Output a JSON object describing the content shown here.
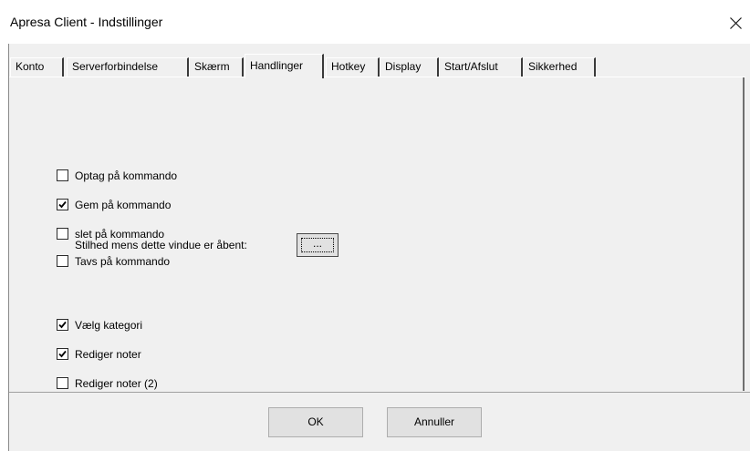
{
  "window": {
    "title": "Apresa Client - Indstillinger",
    "close_icon": "close-icon"
  },
  "tabs": [
    {
      "label": "Konto",
      "active": false
    },
    {
      "label": "Serverforbindelse",
      "active": false
    },
    {
      "label": "Skærm",
      "active": false
    },
    {
      "label": "Handlinger",
      "active": true
    },
    {
      "label": "Hotkey",
      "active": false
    },
    {
      "label": "Display",
      "active": false
    },
    {
      "label": "Start/Afslut",
      "active": false
    },
    {
      "label": "Sikkerhed",
      "active": false
    }
  ],
  "options": [
    {
      "label": "Optag på kommando",
      "checked": false
    },
    {
      "label": "Gem på kommando",
      "checked": true
    },
    {
      "label": "slet på kommando",
      "checked": false
    },
    {
      "label": "Tavs på kommando",
      "checked": false
    },
    {
      "label": "Vælg kategori",
      "checked": true
    },
    {
      "label": "Rediger noter",
      "checked": true
    },
    {
      "label": "Rediger noter (2)",
      "checked": false
    }
  ],
  "silence": {
    "label": "Stilhed mens dette vindue er åbent:",
    "button_label": "..."
  },
  "footer": {
    "ok_label": "OK",
    "cancel_label": "Annuller"
  },
  "colors": {
    "dialog_background": "#f0f0f0",
    "title_background": "#ffffff"
  }
}
